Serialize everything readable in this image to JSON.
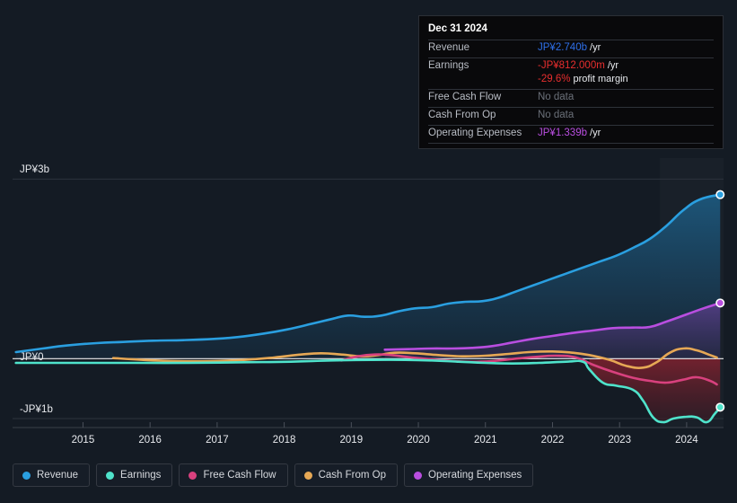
{
  "chart_data": {
    "type": "area",
    "title": "",
    "xlabel": "",
    "ylabel": "",
    "currency": "JP¥",
    "xlim": [
      2014.45,
      2025.05
    ],
    "ylim": [
      -1.15,
      3.35
    ],
    "grid": true,
    "zero_line": true,
    "legend_position": "bottom",
    "y_ticks": [
      {
        "value": 3,
        "label": "JP¥3b"
      },
      {
        "value": 0,
        "label": "JP¥0"
      },
      {
        "value": -1,
        "label": "-JP¥1b"
      }
    ],
    "x_ticks": [
      "2015",
      "2016",
      "2017",
      "2018",
      "2019",
      "2020",
      "2021",
      "2022",
      "2023",
      "2024"
    ],
    "series": [
      {
        "name": "Revenue",
        "color": "#2a9fe0",
        "fill": "#1d4a6b",
        "end_marker": true,
        "points": [
          [
            2014.5,
            0.11
          ],
          [
            2014.9,
            0.17
          ],
          [
            2015.25,
            0.22
          ],
          [
            2015.7,
            0.26
          ],
          [
            2016.1,
            0.28
          ],
          [
            2016.55,
            0.3
          ],
          [
            2017.0,
            0.31
          ],
          [
            2017.45,
            0.33
          ],
          [
            2017.8,
            0.36
          ],
          [
            2018.2,
            0.42
          ],
          [
            2018.55,
            0.49
          ],
          [
            2018.9,
            0.58
          ],
          [
            2019.2,
            0.66
          ],
          [
            2019.45,
            0.72
          ],
          [
            2019.7,
            0.7
          ],
          [
            2019.95,
            0.72
          ],
          [
            2020.2,
            0.79
          ],
          [
            2020.45,
            0.84
          ],
          [
            2020.7,
            0.86
          ],
          [
            2020.95,
            0.92
          ],
          [
            2021.2,
            0.95
          ],
          [
            2021.45,
            0.96
          ],
          [
            2021.7,
            1.02
          ],
          [
            2021.95,
            1.12
          ],
          [
            2022.2,
            1.22
          ],
          [
            2022.45,
            1.32
          ],
          [
            2022.7,
            1.42
          ],
          [
            2022.95,
            1.52
          ],
          [
            2023.2,
            1.62
          ],
          [
            2023.45,
            1.72
          ],
          [
            2023.7,
            1.85
          ],
          [
            2023.95,
            2.0
          ],
          [
            2024.2,
            2.22
          ],
          [
            2024.45,
            2.48
          ],
          [
            2024.7,
            2.66
          ],
          [
            2025.0,
            2.74
          ]
        ]
      },
      {
        "name": "Earnings",
        "color": "#4fe3cb",
        "fill": "",
        "end_marker": true,
        "points": [
          [
            2014.5,
            -0.07
          ],
          [
            2015.4,
            -0.07
          ],
          [
            2016.3,
            -0.07
          ],
          [
            2017.1,
            -0.07
          ],
          [
            2017.9,
            -0.06
          ],
          [
            2018.6,
            -0.05
          ],
          [
            2019.2,
            -0.03
          ],
          [
            2019.8,
            -0.02
          ],
          [
            2020.3,
            -0.02
          ],
          [
            2020.7,
            -0.03
          ],
          [
            2021.1,
            -0.05
          ],
          [
            2021.5,
            -0.07
          ],
          [
            2021.9,
            -0.08
          ],
          [
            2022.3,
            -0.07
          ],
          [
            2022.7,
            -0.05
          ],
          [
            2022.95,
            -0.05
          ],
          [
            2023.05,
            -0.18
          ],
          [
            2023.25,
            -0.4
          ],
          [
            2023.45,
            -0.45
          ],
          [
            2023.7,
            -0.52
          ],
          [
            2023.85,
            -0.7
          ],
          [
            2024.0,
            -0.98
          ],
          [
            2024.15,
            -1.06
          ],
          [
            2024.3,
            -1.0
          ],
          [
            2024.5,
            -0.97
          ],
          [
            2024.65,
            -0.98
          ],
          [
            2024.8,
            -1.06
          ],
          [
            2024.92,
            -0.92
          ],
          [
            2025.0,
            -0.81
          ]
        ]
      },
      {
        "name": "Free Cash Flow",
        "color": "#d8417e",
        "fill": "",
        "end_marker": false,
        "start_year": 2019.35,
        "points": [
          [
            2019.35,
            -0.03
          ],
          [
            2019.6,
            0.04
          ],
          [
            2019.85,
            0.07
          ],
          [
            2020.1,
            0.06
          ],
          [
            2020.4,
            0.02
          ],
          [
            2020.8,
            -0.02
          ],
          [
            2021.2,
            -0.05
          ],
          [
            2021.6,
            -0.04
          ],
          [
            2021.95,
            0.0
          ],
          [
            2022.25,
            0.03
          ],
          [
            2022.55,
            0.05
          ],
          [
            2022.85,
            0.02
          ],
          [
            2023.1,
            -0.1
          ],
          [
            2023.4,
            -0.22
          ],
          [
            2023.7,
            -0.32
          ],
          [
            2023.95,
            -0.37
          ],
          [
            2024.2,
            -0.4
          ],
          [
            2024.45,
            -0.35
          ],
          [
            2024.65,
            -0.31
          ],
          [
            2024.85,
            -0.37
          ],
          [
            2024.95,
            -0.43
          ]
        ]
      },
      {
        "name": "Cash From Op",
        "color": "#e6a855",
        "fill": "",
        "end_marker": false,
        "start_year": 2015.95,
        "points": [
          [
            2015.95,
            0.01
          ],
          [
            2016.4,
            -0.02
          ],
          [
            2016.9,
            -0.04
          ],
          [
            2017.4,
            -0.04
          ],
          [
            2017.9,
            -0.02
          ],
          [
            2018.35,
            0.02
          ],
          [
            2018.75,
            0.07
          ],
          [
            2019.05,
            0.09
          ],
          [
            2019.35,
            0.07
          ],
          [
            2019.65,
            0.04
          ],
          [
            2019.9,
            0.06
          ],
          [
            2020.15,
            0.1
          ],
          [
            2020.45,
            0.09
          ],
          [
            2020.8,
            0.06
          ],
          [
            2021.15,
            0.04
          ],
          [
            2021.5,
            0.05
          ],
          [
            2021.85,
            0.08
          ],
          [
            2022.15,
            0.11
          ],
          [
            2022.5,
            0.12
          ],
          [
            2022.8,
            0.1
          ],
          [
            2023.05,
            0.06
          ],
          [
            2023.35,
            -0.02
          ],
          [
            2023.6,
            -0.12
          ],
          [
            2023.85,
            -0.15
          ],
          [
            2024.05,
            -0.06
          ],
          [
            2024.25,
            0.1
          ],
          [
            2024.45,
            0.17
          ],
          [
            2024.65,
            0.14
          ],
          [
            2024.85,
            0.06
          ],
          [
            2024.95,
            0.02
          ]
        ]
      },
      {
        "name": "Operating Expenses",
        "color": "#b94ee0",
        "fill": "#4a3570",
        "end_marker": true,
        "start_year": 2020.0,
        "points": [
          [
            2020.0,
            0.15
          ],
          [
            2020.35,
            0.16
          ],
          [
            2020.7,
            0.17
          ],
          [
            2021.0,
            0.17
          ],
          [
            2021.3,
            0.18
          ],
          [
            2021.6,
            0.21
          ],
          [
            2021.9,
            0.27
          ],
          [
            2022.2,
            0.33
          ],
          [
            2022.5,
            0.38
          ],
          [
            2022.8,
            0.43
          ],
          [
            2023.1,
            0.47
          ],
          [
            2023.4,
            0.51
          ],
          [
            2023.7,
            0.52
          ],
          [
            2023.95,
            0.53
          ],
          [
            2024.2,
            0.62
          ],
          [
            2024.5,
            0.74
          ],
          [
            2024.75,
            0.84
          ],
          [
            2025.0,
            0.93
          ]
        ]
      }
    ],
    "highlight_band": {
      "from": 2024.1,
      "to": 2025.05
    }
  },
  "tooltip": {
    "date": "Dec 31 2024",
    "rows": [
      {
        "key": "Revenue",
        "value": "JP¥2.740b",
        "unit": "/yr",
        "color": "#2e6fe8",
        "nodata": false,
        "sub": false
      },
      {
        "key": "Earnings",
        "value": "-JP¥812.000m",
        "unit": "/yr",
        "color": "#e82e2e",
        "nodata": false,
        "sub": false
      },
      {
        "key": "",
        "value": "-29.6%",
        "unit": "profit margin",
        "color": "#e82e2e",
        "nodata": false,
        "sub": true
      },
      {
        "key": "Free Cash Flow",
        "value": "No data",
        "unit": "",
        "color": "",
        "nodata": true,
        "sub": false
      },
      {
        "key": "Cash From Op",
        "value": "No data",
        "unit": "",
        "color": "",
        "nodata": true,
        "sub": false
      },
      {
        "key": "Operating Expenses",
        "value": "JP¥1.339b",
        "unit": "/yr",
        "color": "#b94ee0",
        "nodata": false,
        "sub": false
      }
    ]
  },
  "legend": {
    "items": [
      {
        "label": "Revenue",
        "color": "#2a9fe0"
      },
      {
        "label": "Earnings",
        "color": "#4fe3cb"
      },
      {
        "label": "Free Cash Flow",
        "color": "#d8417e"
      },
      {
        "label": "Cash From Op",
        "color": "#e6a855"
      },
      {
        "label": "Operating Expenses",
        "color": "#b94ee0"
      }
    ]
  },
  "theme": {
    "background": "#141b24",
    "grid_color": "#2c333d",
    "zero_line_color": "#ffffff",
    "axis_text": "#e8eaee"
  }
}
